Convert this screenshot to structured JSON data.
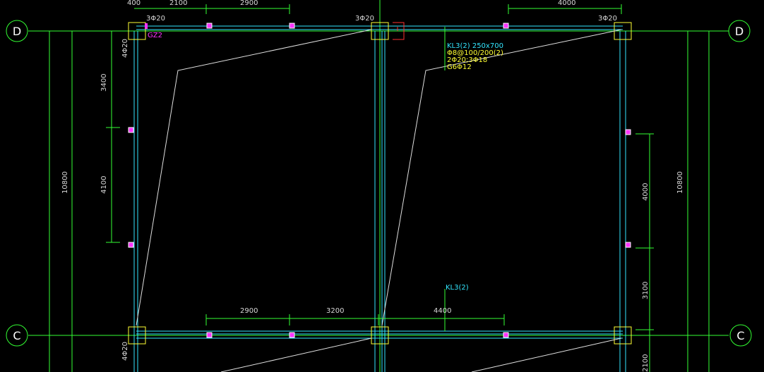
{
  "grid_axes": {
    "top_left": "D",
    "top_right": "D",
    "bottom_left": "C",
    "bottom_right": "C"
  },
  "dimensions": {
    "top": [
      "400",
      "2100",
      "2900",
      "4000"
    ],
    "left_vertical": [
      "3400",
      "4100"
    ],
    "right_vertical": [
      "4000",
      "3100",
      "2100"
    ],
    "overall_left": "10800",
    "overall_right": "10800",
    "bottom": [
      "2900",
      "3200",
      "4400"
    ]
  },
  "annotations": {
    "rebar_top_left": "3Φ20",
    "rebar_top_mid": "3Φ20",
    "rebar_top_right": "3Φ20",
    "rebar_left_top": "4Φ20",
    "rebar_left_bottom": "4Φ20",
    "column_tag": "GZ2",
    "beam_label_1": "KL3(2) 250x700",
    "beam_label_2": "Φ8@100/200(2)",
    "beam_label_3": "2Φ20;3Φ18",
    "beam_label_4": "G6Φ12",
    "beam_label_lower": "KL3(2)"
  },
  "colors": {
    "background": "#000000",
    "grid_line": "#33ff33",
    "beam_line": "#33e6ff",
    "column": "#ffff33",
    "marker": "#ff33ff",
    "slab_line": "#e0e0e0",
    "red_mark": "#ff3030"
  }
}
